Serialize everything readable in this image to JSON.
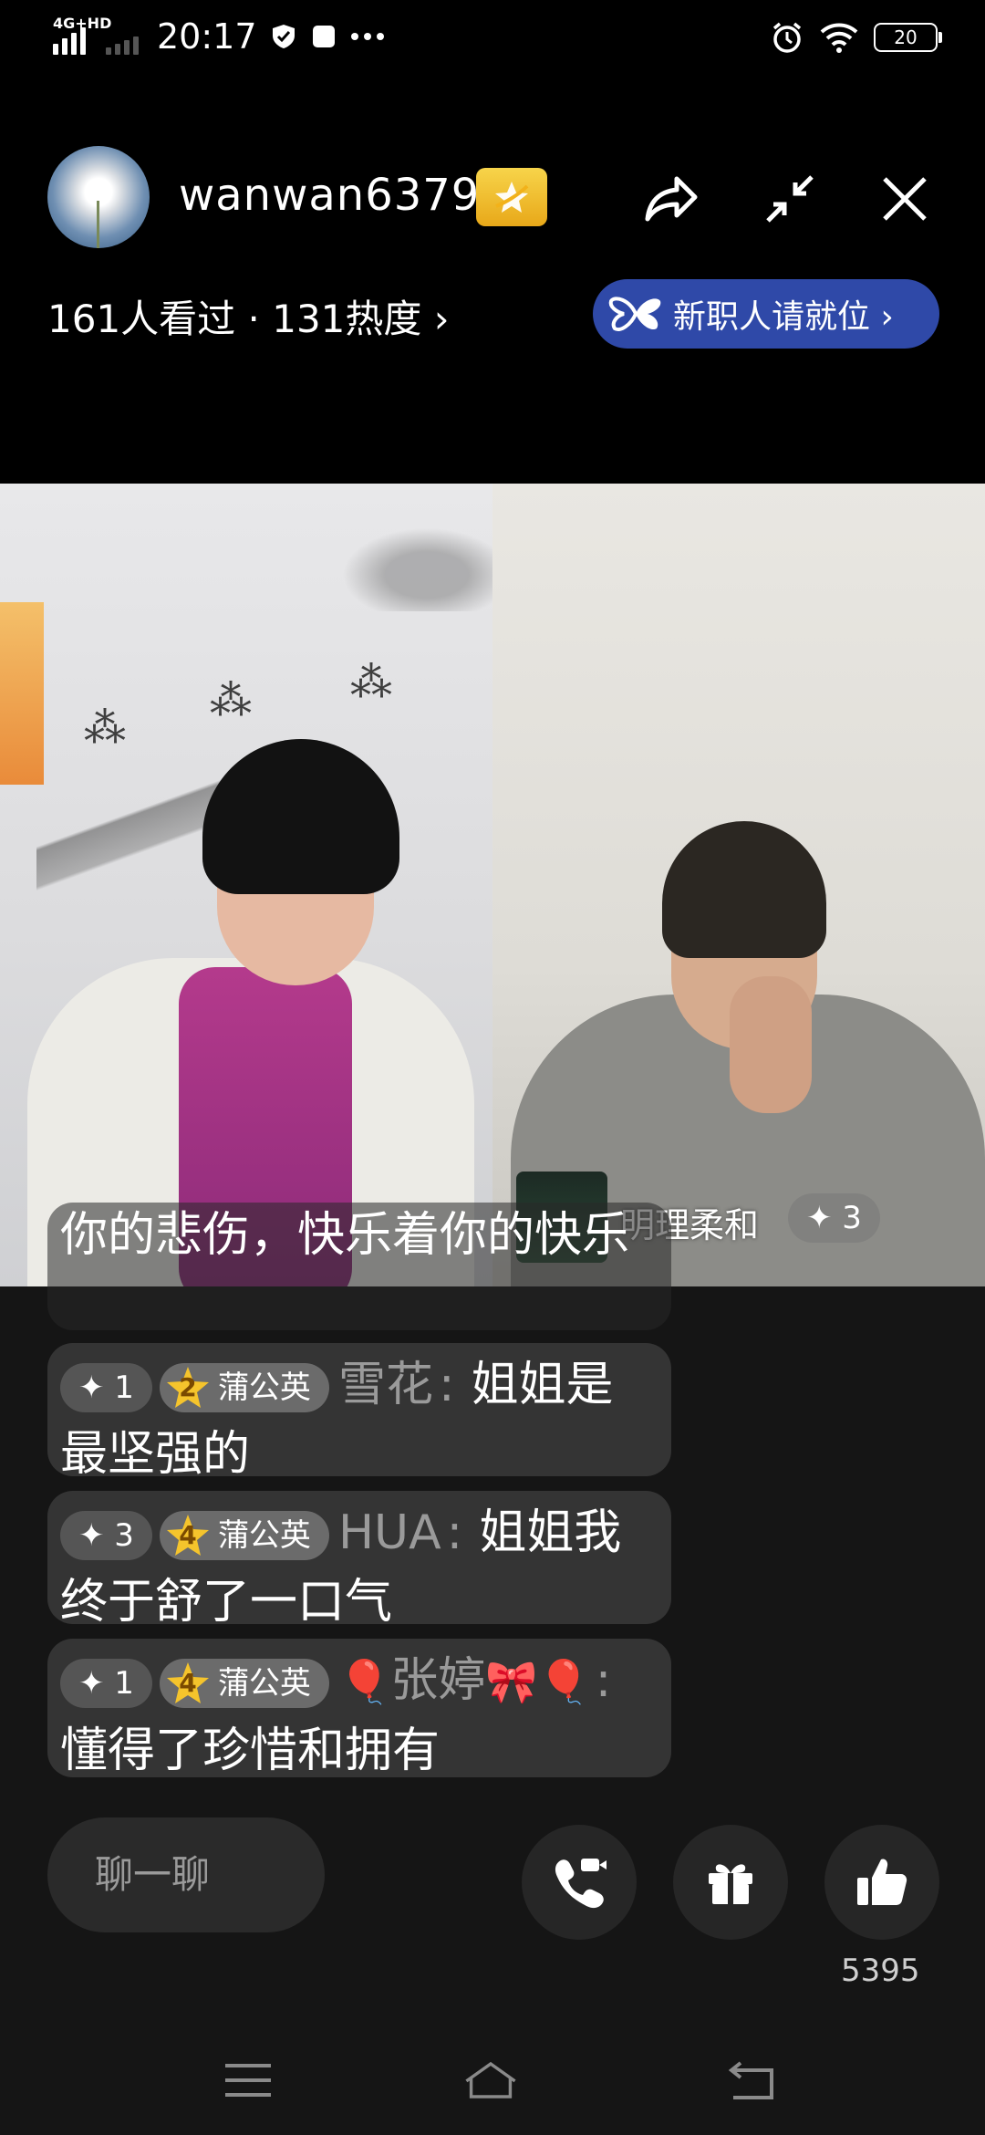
{
  "status_bar": {
    "network": "4G+HD",
    "time": "20:17",
    "battery": "20"
  },
  "header": {
    "host_name": "wanwan6379",
    "views_text": "161人看过 · 131热度 ›",
    "hire_pill_label": "新职人请就位 ›"
  },
  "video": {
    "guest_name": "明理柔和",
    "guest_level": "✦ 3"
  },
  "chat": {
    "messages": [
      {
        "text": "你的悲伤，快乐着你的快乐"
      },
      {
        "level": "✦ 1",
        "fan_rank": "2",
        "fan_club": "蒲公英",
        "user": "雪花",
        "colon": ":",
        "text": "姐姐是最坚强的"
      },
      {
        "level": "✦ 3",
        "fan_rank": "4",
        "fan_club": "蒲公英",
        "user": "HUA",
        "colon": ":",
        "text": "姐姐我终于舒了一口气"
      },
      {
        "level": "✦ 1",
        "fan_rank": "4",
        "fan_club": "蒲公英",
        "user_prefix": "🎈",
        "user": "张婷",
        "user_suffix": "🎀",
        "user_tail": "🎈",
        "colon": ":",
        "text": "懂得了珍惜和拥有"
      }
    ]
  },
  "bottom": {
    "chat_placeholder": "聊一聊",
    "like_count": "5395"
  },
  "icons": {
    "share": "share-icon",
    "minimize": "minimize-icon",
    "close": "close-icon",
    "call": "video-call-icon",
    "gift": "gift-icon",
    "like": "thumbs-up-icon"
  },
  "colors": {
    "background": "#000000",
    "pill": "#2f49a8",
    "star_badge": "#f2c232"
  }
}
